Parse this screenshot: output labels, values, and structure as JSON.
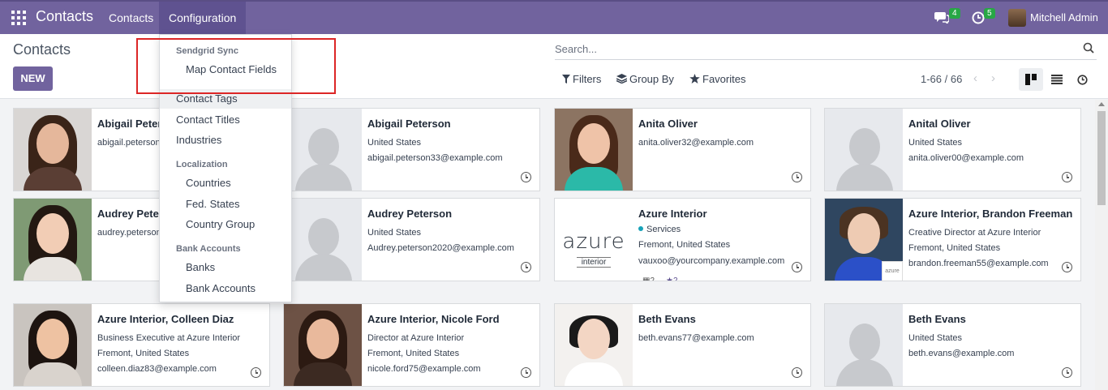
{
  "navbar": {
    "brand": "Contacts",
    "menus": [
      "Contacts",
      "Configuration"
    ],
    "messages_count": "4",
    "activities_count": "5",
    "user_name": "Mitchell Admin"
  },
  "control_panel": {
    "title": "Contacts",
    "new_label": "NEW",
    "search_placeholder": "Search...",
    "filters_label": "Filters",
    "group_by_label": "Group By",
    "favorites_label": "Favorites",
    "pager": "1-66 / 66"
  },
  "dropdown": {
    "section_sendgrid": "Sendgrid Sync",
    "map_contact_fields": "Map Contact Fields",
    "contact_tags": "Contact Tags",
    "contact_titles": "Contact Titles",
    "industries": "Industries",
    "section_localization": "Localization",
    "countries": "Countries",
    "fed_states": "Fed. States",
    "country_group": "Country Group",
    "section_bank": "Bank Accounts",
    "banks": "Banks",
    "bank_accounts": "Bank Accounts"
  },
  "cards": [
    {
      "name": "Abigail Peterson",
      "lines": [
        "abigail.peterson39@example.com"
      ]
    },
    {
      "name": "Abigail Peterson",
      "lines": [
        "United States",
        "abigail.peterson33@example.com"
      ]
    },
    {
      "name": "Anita Oliver",
      "lines": [
        "anita.oliver32@example.com"
      ]
    },
    {
      "name": "Anital Oliver",
      "lines": [
        "United States",
        "anita.oliver00@example.com"
      ]
    },
    {
      "name": "Audrey Peterson",
      "lines": [
        "audrey.peterson25@example.com"
      ]
    },
    {
      "name": "Audrey Peterson",
      "lines": [
        "United States",
        "Audrey.peterson2020@example.com"
      ]
    },
    {
      "name": "Azure Interior",
      "tag": "Services",
      "lines": [
        "Fremont, United States",
        "vauxoo@yourcompany.example.com"
      ],
      "meetings": "2",
      "stars": "2",
      "logo_big": "azure",
      "logo_small": "interior"
    },
    {
      "name": "Azure Interior, Brandon Freeman",
      "lines": [
        "Creative Director at Azure Interior",
        "Fremont, United States",
        "brandon.freeman55@example.com"
      ],
      "badge": "azure"
    },
    {
      "name": "Azure Interior, Colleen Diaz",
      "lines": [
        "Business Executive at Azure Interior",
        "Fremont, United States",
        "colleen.diaz83@example.com"
      ]
    },
    {
      "name": "Azure Interior, Nicole Ford",
      "lines": [
        "Director at Azure Interior",
        "Fremont, United States",
        "nicole.ford75@example.com"
      ]
    },
    {
      "name": "Beth Evans",
      "lines": [
        "beth.evans77@example.com"
      ]
    },
    {
      "name": "Beth Evans",
      "lines": [
        "United States",
        "beth.evans@example.com"
      ]
    }
  ],
  "colors": {
    "brand": "#71639e",
    "highlight_border": "#dc2626",
    "badge_green": "#28a745"
  }
}
